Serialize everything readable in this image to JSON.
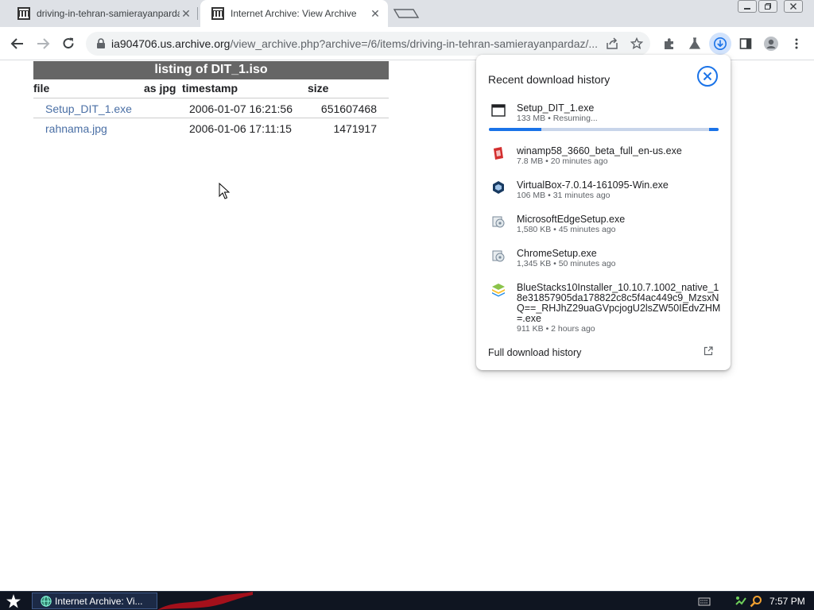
{
  "browser": {
    "tabs": [
      {
        "title": "driving-in-tehran-samierayanpardaz"
      },
      {
        "title": "Internet Archive: View Archive"
      }
    ],
    "url_host": "ia904706.us.archive.org",
    "url_rest": "/view_archive.php?archive=/6/items/driving-in-tehran-samierayanpardaz/..."
  },
  "listing": {
    "caption": "listing of DIT_1.iso",
    "headers": {
      "file": "file",
      "as_jpg": "as jpg",
      "timestamp": "timestamp",
      "size": "size"
    },
    "rows": [
      {
        "file": "Setup_DIT_1.exe",
        "timestamp": "2006-01-07 16:21:56",
        "size": "651607468"
      },
      {
        "file": "rahnama.jpg",
        "timestamp": "2006-01-06 17:11:15",
        "size": "1471917"
      }
    ]
  },
  "downloads": {
    "title": "Recent download history",
    "active": {
      "name": "Setup_DIT_1.exe",
      "status": "133 MB • Resuming...",
      "progress": 0.23
    },
    "items": [
      {
        "name": "winamp58_3660_beta_full_en-us.exe",
        "status": "7.8 MB • 20 minutes ago",
        "icon": "winamp-icon",
        "color": "#d32f2f"
      },
      {
        "name": "VirtualBox-7.0.14-161095-Win.exe",
        "status": "106 MB • 31 minutes ago",
        "icon": "virtualbox-icon",
        "color": "#183a61"
      },
      {
        "name": "MicrosoftEdgeSetup.exe",
        "status": "1,580 KB • 45 minutes ago",
        "icon": "installer-icon",
        "color": "#7a8a9a"
      },
      {
        "name": "ChromeSetup.exe",
        "status": "1,345 KB • 50 minutes ago",
        "icon": "installer-icon",
        "color": "#7a8a9a"
      }
    ],
    "bluestacks": {
      "name_lines": [
        "BlueStacks10Installer_10.10.7.1002_native_1",
        "8e31857905da178822c8c5f4ac449c9_MzsxN",
        "Q==_RHJhZ29uaGVpcjogU2lsZW50IEdvZHM",
        "=.exe"
      ],
      "status": "911 KB • 2 hours ago"
    },
    "footer": "Full download history"
  },
  "taskbar": {
    "task_title": "Internet Archive: Vi...",
    "clock": "7:57 PM"
  },
  "colors": {
    "accent": "#1a73e8",
    "table_caption": "#666666",
    "link": "#4a6fa5"
  }
}
